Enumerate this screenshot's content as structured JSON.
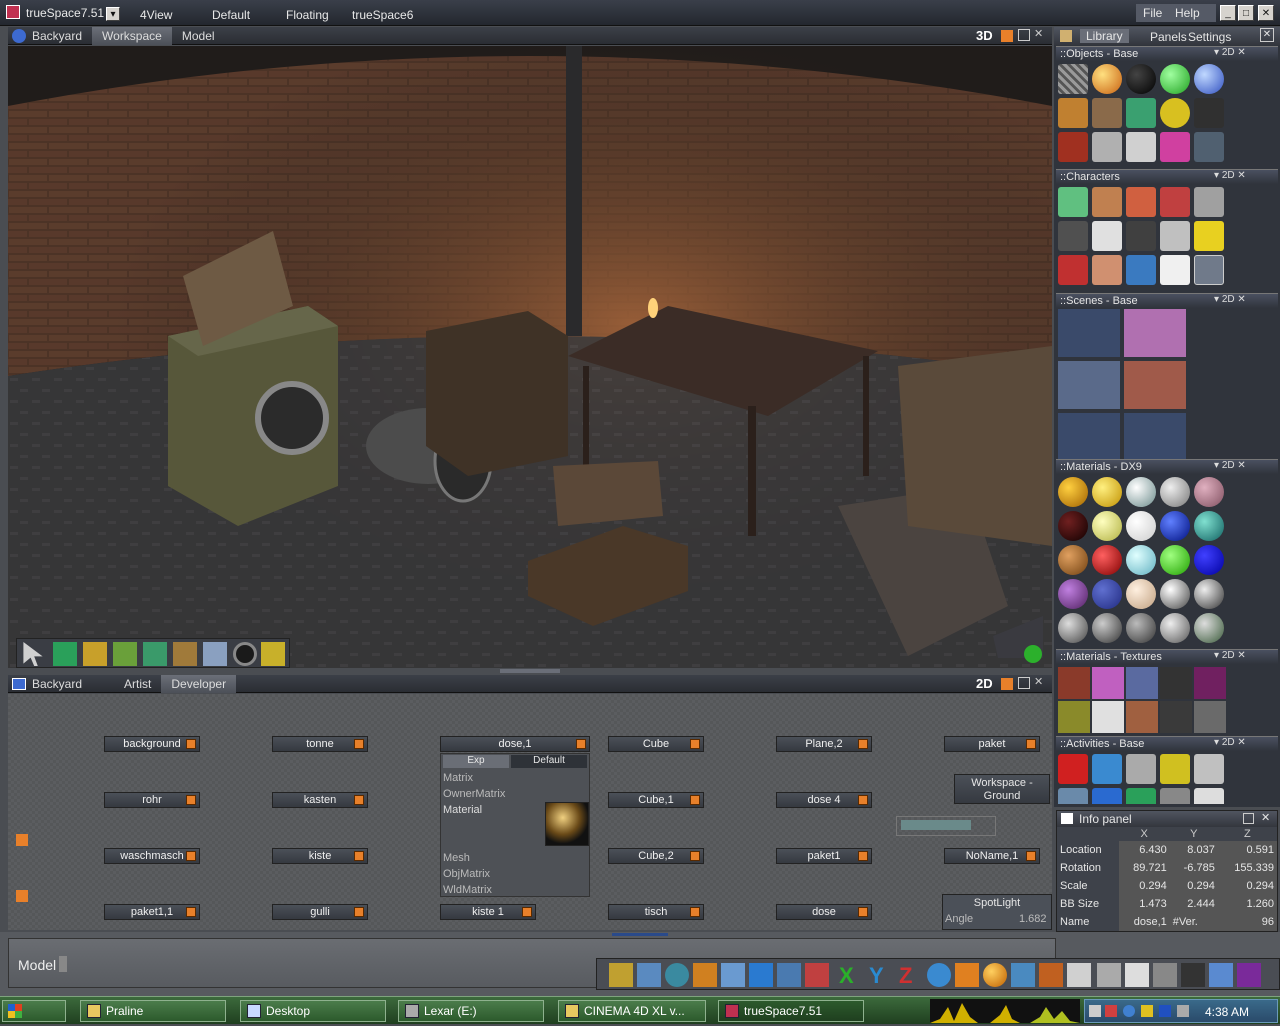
{
  "titlebar": {
    "app_title": "trueSpace7.51",
    "menu": [
      "4View",
      "Default",
      "Floating",
      "trueSpace6"
    ],
    "right_menu": [
      "File",
      "Help"
    ]
  },
  "view3d": {
    "tabs": [
      "Backyard",
      "Workspace",
      "Model"
    ],
    "active_tab": "Workspace",
    "mode_badge": "3D"
  },
  "nodes_panel": {
    "tabs": [
      "Backyard",
      "Artist",
      "Developer"
    ],
    "mode_badge": "2D",
    "nodes": [
      "background",
      "tonne",
      "dose,1",
      "Cube",
      "Plane,2",
      "paket",
      "rohr",
      "kasten",
      "Cube,1",
      "dose 4",
      "waschmasch",
      "kiste",
      "Cube,2",
      "paket1",
      "NoName,1",
      "paket1,1",
      "gulli",
      "kiste 1",
      "tisch",
      "dose"
    ],
    "expanded_node": {
      "tabs": [
        "Exp",
        "Default"
      ],
      "ports_top": [
        "Matrix",
        "OwnerMatrix",
        "Material"
      ],
      "ports_bottom": [
        "Mesh",
        "ObjMatrix",
        "WldMatrix"
      ]
    },
    "workspace_ground": "Workspace - Ground",
    "spotlight": {
      "title": "SpotLight",
      "angle_label": "Angle",
      "angle_value": "1.682"
    }
  },
  "library": {
    "tabs": [
      "Library",
      "Panels",
      "Settings"
    ],
    "sections": [
      "Objects - Base",
      "Characters",
      "Scenes - Base",
      "Materials - DX9",
      "Materials - Textures",
      "Activities - Base"
    ],
    "badge": "2D"
  },
  "info_panel": {
    "title": "Info panel",
    "cols": [
      "X",
      "Y",
      "Z"
    ],
    "rows": [
      {
        "label": "Location",
        "x": "6.430",
        "y": "8.037",
        "z": "0.591"
      },
      {
        "label": "Rotation",
        "x": "89.721",
        "y": "-6.785",
        "z": "155.339"
      },
      {
        "label": "Scale",
        "x": "0.294",
        "y": "0.294",
        "z": "0.294"
      },
      {
        "label": "BB Size",
        "x": "1.473",
        "y": "2.444",
        "z": "1.260"
      }
    ],
    "name_label": "Name",
    "name_value": "dose,1",
    "ver_label": "#Ver.",
    "ver_value": "96"
  },
  "status": {
    "mode_label": "Model"
  },
  "taskbar": {
    "tasks": [
      "Praline",
      "Desktop",
      "Lexar (E:)",
      "CINEMA 4D XL v...",
      "trueSpace7.51"
    ],
    "clock": "4:38 AM"
  },
  "colors": {
    "accent": "#e8802a",
    "taskbar": "#2c5a2c",
    "panel": "#30343c"
  }
}
